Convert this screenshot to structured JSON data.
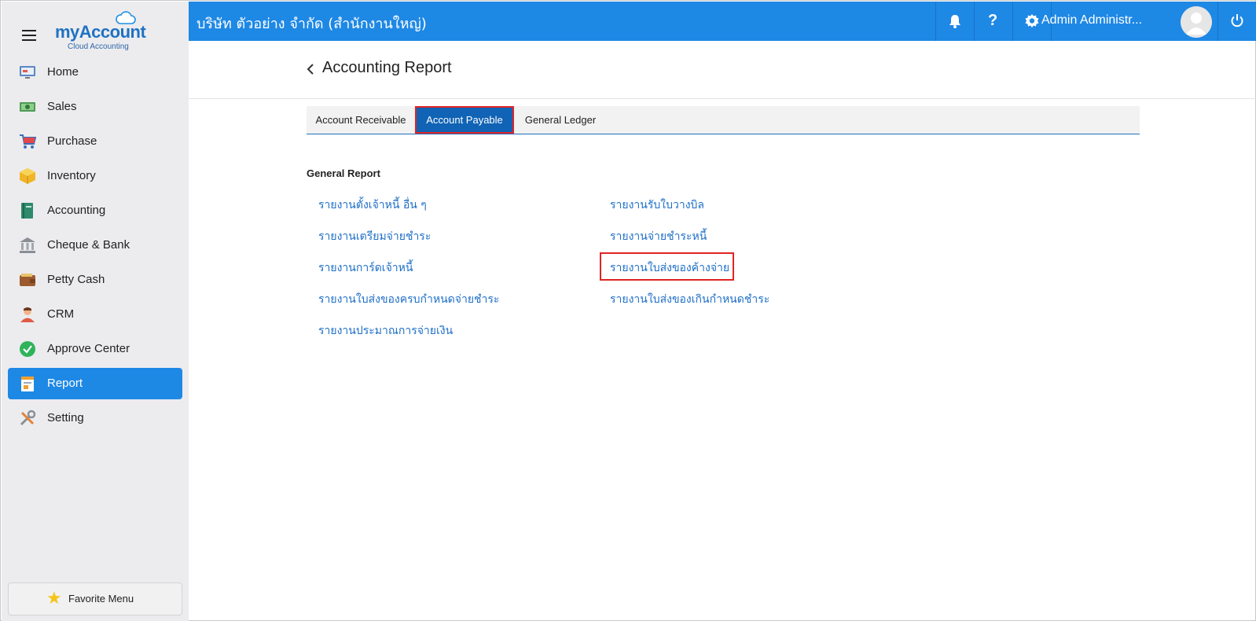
{
  "sidebar": {
    "logo": {
      "name": "myAccount",
      "name_prefix": "my",
      "name_suffix": "Account",
      "tagline": "Cloud Accounting"
    },
    "items": [
      {
        "label": "Home",
        "icon": "home-monitor-icon"
      },
      {
        "label": "Sales",
        "icon": "cash-icon"
      },
      {
        "label": "Purchase",
        "icon": "cart-icon"
      },
      {
        "label": "Inventory",
        "icon": "box-icon"
      },
      {
        "label": "Accounting",
        "icon": "ledger-book-icon"
      },
      {
        "label": "Cheque & Bank",
        "icon": "bank-icon"
      },
      {
        "label": "Petty Cash",
        "icon": "wallet-icon"
      },
      {
        "label": "CRM",
        "icon": "person-icon"
      },
      {
        "label": "Approve Center",
        "icon": "check-circle-icon"
      },
      {
        "label": "Report",
        "icon": "report-icon",
        "active": true
      },
      {
        "label": "Setting",
        "icon": "tools-icon"
      }
    ],
    "favorite": {
      "label": "Favorite Menu",
      "icon": "star-icon"
    }
  },
  "topbar": {
    "company": "บริษัท ตัวอย่าง จำกัด (สำนักงานใหญ่)",
    "user_name": "Admin Administr...",
    "icons": [
      "bell-icon",
      "help-icon",
      "gear-icon",
      "avatar",
      "power-icon"
    ]
  },
  "page": {
    "title": "Accounting Report",
    "tabs": [
      {
        "label": "Account Receivable"
      },
      {
        "label": "Account Payable",
        "active": true
      },
      {
        "label": "General Ledger"
      }
    ],
    "section_title": "General Report",
    "reports_left": [
      "รายงานตั้งเจ้าหนี้ อื่น ๆ",
      "รายงานเตรียมจ่ายชำระ",
      "รายงานการ์ดเจ้าหนี้",
      "รายงานใบส่งของครบกำหนดจ่ายชำระ",
      "รายงานประมาณการจ่ายเงิน"
    ],
    "reports_right": [
      "รายงานรับใบวางบิล",
      "รายงานจ่ายชำระหนี้",
      "รายงานใบส่งของค้างจ่าย",
      "รายงานใบส่งของเกินกำหนดชำระ"
    ]
  },
  "colors": {
    "accent": "#1e88e5",
    "tab_active": "#1063b5",
    "link": "#1e6fc8",
    "highlight": "#e02424",
    "sidebar_bg": "#ececef"
  }
}
